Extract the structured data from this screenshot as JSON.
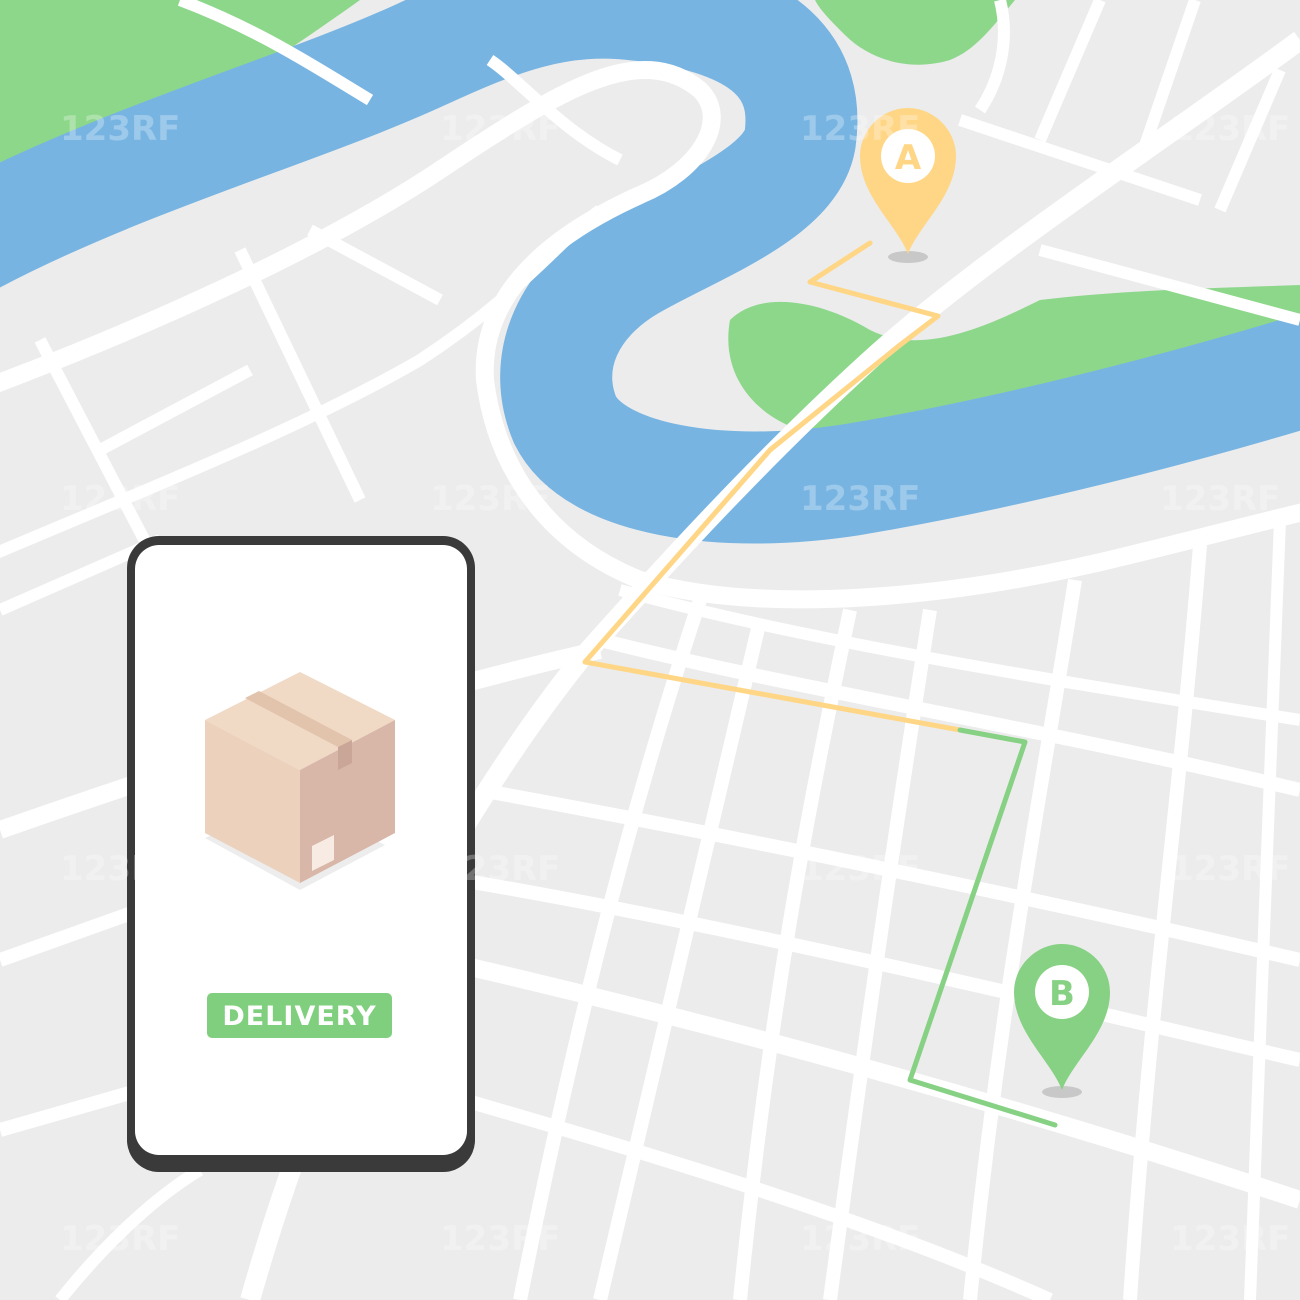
{
  "map": {
    "colors": {
      "land": "#ececec",
      "road": "#ffffff",
      "water": "#77b4e2",
      "park": "#8dd78b",
      "route_start": "#ffd686",
      "route_end": "#86d183",
      "pin_a": "#ffd686",
      "pin_b": "#86d183"
    }
  },
  "markers": {
    "a": {
      "label": "A"
    },
    "b": {
      "label": "B"
    }
  },
  "phone": {
    "badge_label": "DELIVERY",
    "badge_color": "#7fcf7e",
    "icon": "package-box-icon"
  },
  "watermark": {
    "text": "123RF"
  }
}
